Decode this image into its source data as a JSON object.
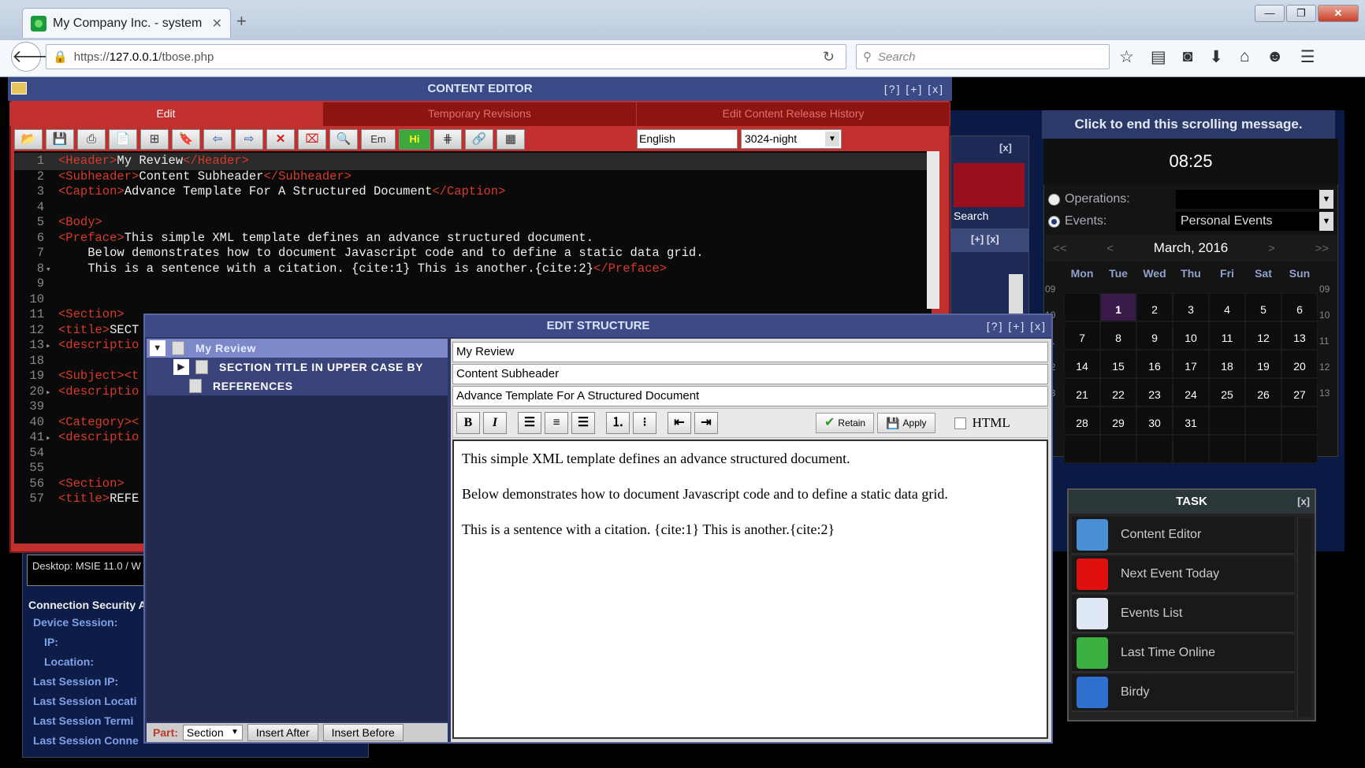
{
  "browser": {
    "tab_title": "My Company Inc. - system",
    "tab_close": "✕",
    "new_tab": "+",
    "url_prefix": "https://",
    "url_host": "127.0.0.1",
    "url_path": "/tbose.php",
    "search_placeholder": "Search",
    "window_buttons": [
      "—",
      "❐",
      "✕"
    ],
    "nav_icons": [
      "star-icon",
      "bookmarks-icon",
      "pocket-icon",
      "download-icon",
      "home-icon",
      "chat-icon",
      "menu-icon"
    ]
  },
  "content_editor": {
    "title": "CONTENT EDITOR",
    "controls": "[?] [+] [x]",
    "tabs": [
      "Edit",
      "Temporary Revisions",
      "Edit Content Release History"
    ],
    "active_tab": "Edit",
    "toolbar": {
      "em_label": "Em",
      "hi_label": "Hi",
      "language": "English",
      "theme": "3024-night"
    },
    "code_lines": [
      {
        "n": "1",
        "fold": "",
        "parts": [
          [
            "tag",
            "<Header>"
          ],
          [
            "txt",
            "My Review"
          ],
          [
            "tag",
            "</Header>"
          ]
        ]
      },
      {
        "n": "2",
        "fold": "",
        "parts": [
          [
            "tag",
            "<Subheader>"
          ],
          [
            "txt",
            "Content Subheader"
          ],
          [
            "tag",
            "</Subheader>"
          ]
        ]
      },
      {
        "n": "3",
        "fold": "",
        "parts": [
          [
            "tag",
            "<Caption>"
          ],
          [
            "txt",
            "Advance Template For A Structured Document"
          ],
          [
            "tag",
            "</Caption>"
          ]
        ]
      },
      {
        "n": "4",
        "fold": "",
        "parts": []
      },
      {
        "n": "5",
        "fold": "",
        "parts": [
          [
            "tag",
            "<Body>"
          ]
        ]
      },
      {
        "n": "6",
        "fold": "",
        "parts": [
          [
            "tag",
            "<Preface>"
          ],
          [
            "txt",
            "This simple XML template defines an advance structured document."
          ]
        ]
      },
      {
        "n": "7",
        "fold": "",
        "parts": [
          [
            "txt",
            "    Below demonstrates how to document Javascript code and to define a static data grid."
          ]
        ]
      },
      {
        "n": "8",
        "fold": "▾",
        "parts": [
          [
            "txt",
            "    This is a sentence with a citation. {cite:1} This is another.{cite:2}"
          ],
          [
            "tag",
            "</Preface>"
          ]
        ]
      },
      {
        "n": "9",
        "fold": "",
        "parts": []
      },
      {
        "n": "10",
        "fold": "",
        "parts": []
      },
      {
        "n": "11",
        "fold": "",
        "parts": [
          [
            "tag",
            "<Section>"
          ]
        ]
      },
      {
        "n": "12",
        "fold": "",
        "parts": [
          [
            "tag",
            "<title>"
          ],
          [
            "txt",
            "SECT"
          ]
        ]
      },
      {
        "n": "13",
        "fold": "▸",
        "parts": [
          [
            "tag",
            "<descriptio"
          ]
        ]
      },
      {
        "n": "18",
        "fold": "",
        "parts": []
      },
      {
        "n": "19",
        "fold": "",
        "parts": [
          [
            "tag",
            "<Subject><t"
          ]
        ]
      },
      {
        "n": "20",
        "fold": "▸",
        "parts": [
          [
            "tag",
            "<descriptio"
          ]
        ]
      },
      {
        "n": "39",
        "fold": "",
        "parts": []
      },
      {
        "n": "40",
        "fold": "",
        "parts": [
          [
            "tag",
            "<Category><"
          ]
        ]
      },
      {
        "n": "41",
        "fold": "▸",
        "parts": [
          [
            "tag",
            "<descriptio"
          ]
        ]
      },
      {
        "n": "54",
        "fold": "",
        "parts": []
      },
      {
        "n": "55",
        "fold": "",
        "parts": []
      },
      {
        "n": "56",
        "fold": "",
        "parts": [
          [
            "tag",
            "<Section>"
          ]
        ]
      },
      {
        "n": "57",
        "fold": "",
        "parts": [
          [
            "tag",
            "<title>"
          ],
          [
            "txt",
            "REFE"
          ]
        ]
      }
    ]
  },
  "edit_structure": {
    "title": "EDIT STRUCTURE",
    "controls": "[?] [+] [x]",
    "tree": [
      {
        "label": "My Review",
        "toggle": "▼",
        "selected": true
      },
      {
        "label": "SECTION TITLE IN UPPER CASE BY",
        "toggle": "▶",
        "selected": false
      },
      {
        "label": "REFERENCES",
        "toggle": "",
        "selected": false
      }
    ],
    "fields": [
      "My Review",
      "Content Subheader",
      "Advance Template For A Structured Document"
    ],
    "rte_buttons": {
      "bold": "B",
      "italic": "I",
      "retain": "Retain",
      "apply": "Apply",
      "html": "HTML"
    },
    "body_paragraphs": [
      "This simple XML template defines an advance structured document.",
      "Below demonstrates how to document Javascript code and to define a static data grid.",
      "This is a sentence with a citation.  {cite:1} This is another.{cite:2}"
    ],
    "part_label": "Part:",
    "part_value": "Section",
    "insert_after": "Insert After",
    "insert_before": "Insert Before"
  },
  "side_panel": {
    "close": "[x]",
    "search_label": "Search",
    "controls2": "[+]  [x]"
  },
  "clock_widget": {
    "scroll_message": "Click to end this scrolling message.",
    "time": "08:25",
    "operations_label": "Operations:",
    "operations_value": "",
    "events_label": "Events:",
    "events_value": "Personal Events",
    "month": "March, 2016",
    "prev_year": "<<",
    "prev": "<",
    "next": ">",
    "next_year": ">>",
    "days_of_week": [
      "Mon",
      "Tue",
      "Wed",
      "Thu",
      "Fri",
      "Sat",
      "Sun"
    ],
    "weeks": [
      {
        "wk": "09",
        "days": [
          "",
          "1",
          "2",
          "3",
          "4",
          "5",
          "6"
        ]
      },
      {
        "wk": "10",
        "days": [
          "7",
          "8",
          "9",
          "10",
          "11",
          "12",
          "13"
        ]
      },
      {
        "wk": "11",
        "days": [
          "14",
          "15",
          "16",
          "17",
          "18",
          "19",
          "20"
        ]
      },
      {
        "wk": "12",
        "days": [
          "21",
          "22",
          "23",
          "24",
          "25",
          "26",
          "27"
        ]
      },
      {
        "wk": "13",
        "days": [
          "28",
          "29",
          "30",
          "31",
          "",
          "",
          ""
        ]
      },
      {
        "wk": "",
        "days": [
          "",
          "",
          "",
          "",
          "",
          "",
          ""
        ]
      }
    ],
    "today": "1"
  },
  "task_panel": {
    "title": "TASK",
    "close": "[x]",
    "items": [
      {
        "label": "Content Editor",
        "icon": "content-editor-icon",
        "color": "#4a8fd6"
      },
      {
        "label": "Next Event Today",
        "icon": "alert-burst-icon",
        "color": "#e01010"
      },
      {
        "label": "Events List",
        "icon": "list-icon",
        "color": "#dfe8f5"
      },
      {
        "label": "Last Time Online",
        "icon": "clock-icon",
        "color": "#3cb043"
      },
      {
        "label": "Birdy",
        "icon": "bird-icon",
        "color": "#2e6fd0"
      }
    ]
  },
  "security_panel": {
    "desktop_info": "Desktop: MSIE 11.0 / W",
    "heading": "Connection Security A",
    "rows": [
      "Device Session:",
      "IP:",
      "Location:",
      "Last Session IP:",
      "Last Session Locati",
      "Last Session Termi",
      "Last Session Conne"
    ]
  }
}
